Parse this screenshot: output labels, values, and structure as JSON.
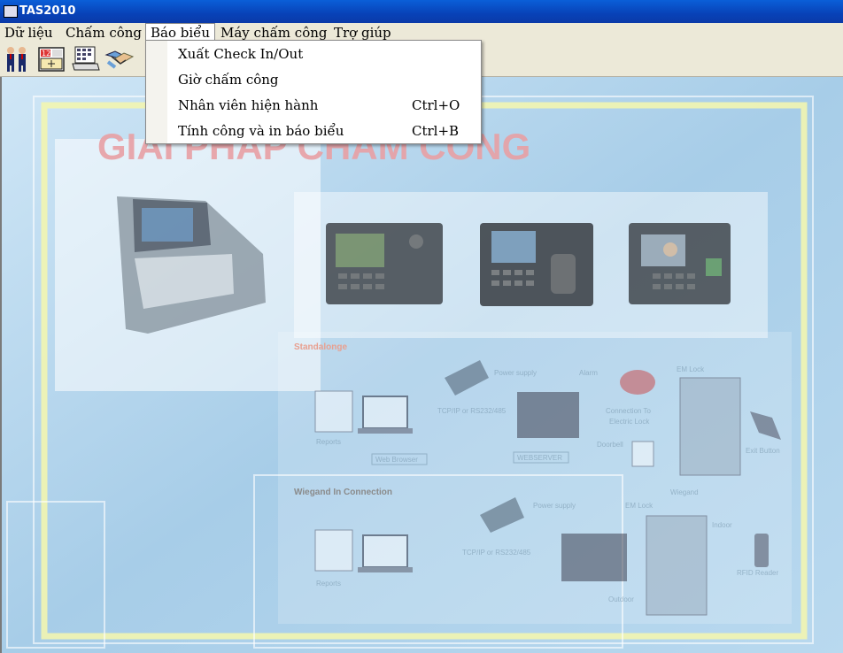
{
  "window": {
    "title": "TAS2010"
  },
  "menu": {
    "items": [
      "Dữ liệu",
      "Chấm công",
      "Báo biểu",
      "Máy chấm công",
      "Trợ giúp"
    ],
    "active": "Báo biểu"
  },
  "dropdown": {
    "items": [
      {
        "label": "Xuất Check In/Out",
        "shortcut": ""
      },
      {
        "label": "Giờ chấm công",
        "shortcut": ""
      },
      {
        "label": "Nhân viên hiện hành",
        "shortcut": "Ctrl+O"
      },
      {
        "label": "Tính công và in báo biểu",
        "shortcut": "Ctrl+B"
      }
    ]
  },
  "toolbar": {
    "buttons": [
      "employees-icon",
      "calendar-icon",
      "report-icon",
      "handshake-icon"
    ]
  },
  "background": {
    "headline": "GIẢI PHÁP CHẤM CÔNG",
    "section1": "Standalonge",
    "section2": "Wiegand In Connection",
    "labels": {
      "power_supply": "Power supply",
      "alarm": "Alarm",
      "em_lock": "EM Lock",
      "tcpip": "TCP/IP or RS232/485",
      "connection_to": "Connection To",
      "electric_lock": "Electric Lock",
      "reports": "Reports",
      "web_browser": "Web Browser",
      "webserver": "WEBSERVER",
      "doorbell": "Doorbell",
      "exit_button": "Exit Button",
      "wiegand": "Wiegand",
      "indoor": "Indoor",
      "outdoor": "Outdoor",
      "rfid_reader": "RFID Reader"
    }
  },
  "colors": {
    "titlebar": "#0842b8",
    "menubar": "#ece9d8",
    "client_bg": "#a9cfe8",
    "headline": "#e8a0a4"
  }
}
